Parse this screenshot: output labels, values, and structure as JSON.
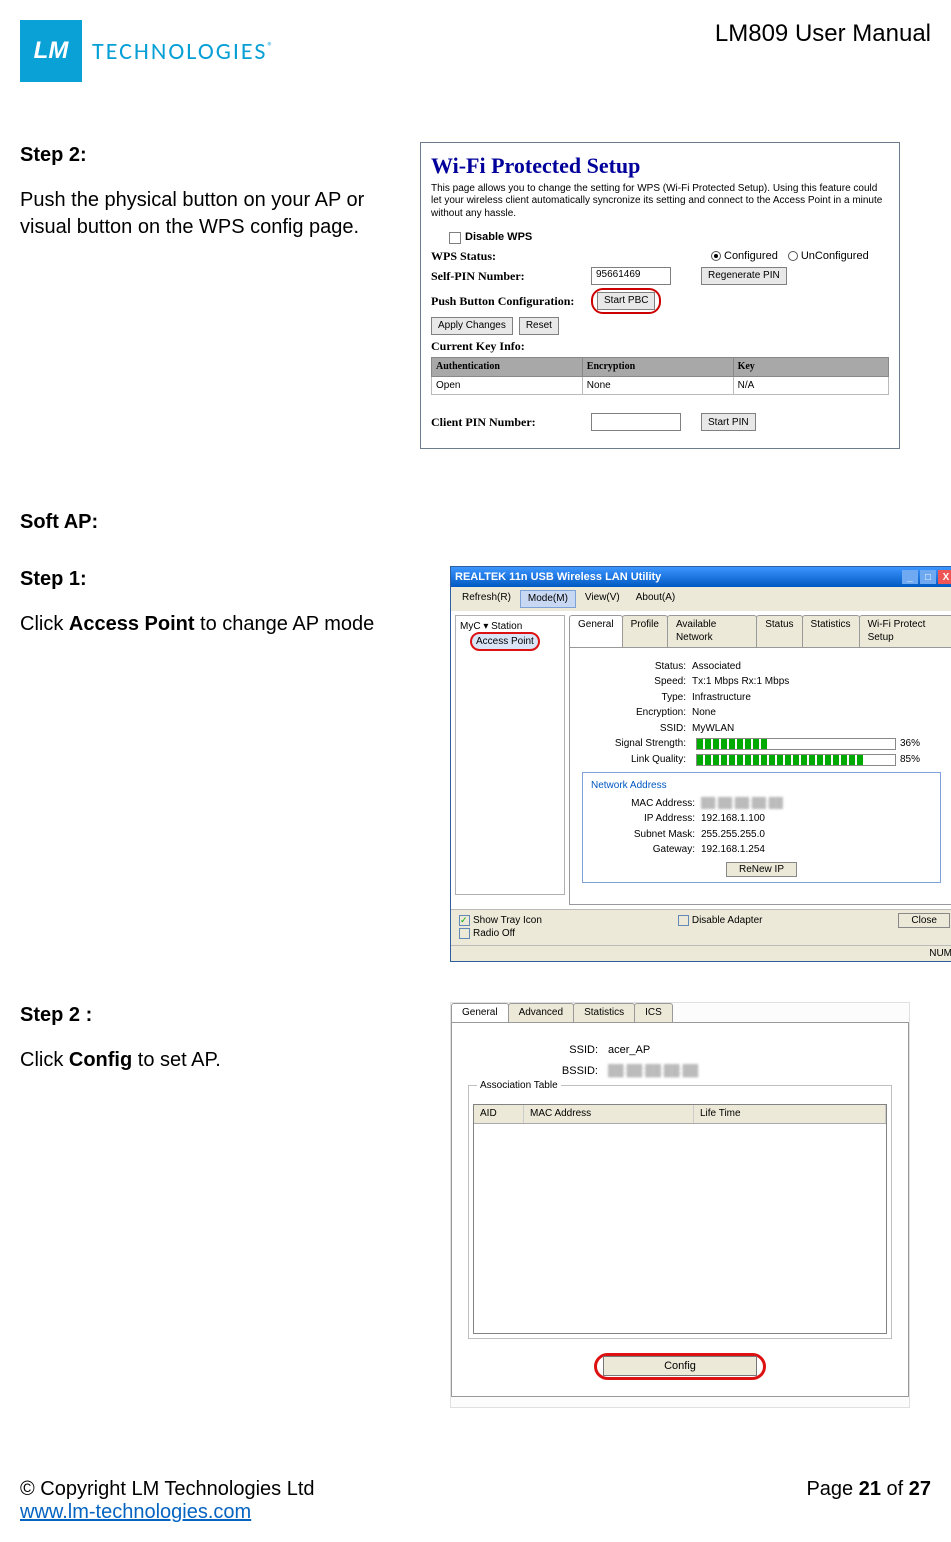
{
  "header": {
    "logo_text": "TECHNOLOGIES",
    "logo_mark": "LM",
    "reg": "®",
    "doc_title": "LM809 User Manual"
  },
  "section1": {
    "step_label": "Step 2:",
    "para": "Push the physical button on your AP or visual button on the WPS config page.",
    "shot": {
      "title": "Wi-Fi Protected Setup",
      "desc": "This page allows you to change the setting for WPS (Wi-Fi Protected Setup). Using this feature could let your wireless client automatically syncronize its setting and connect to the Access Point in a minute without any hassle.",
      "disable_wps_label": "Disable WPS",
      "rows": {
        "status_lbl": "WPS Status:",
        "status_opt1": "Configured",
        "status_opt2": "UnConfigured",
        "pin_lbl": "Self-PIN Number:",
        "pin_val": "95661469",
        "regen_btn": "Regenerate PIN",
        "pbc_lbl": "Push Button Configuration:",
        "pbc_btn": "Start PBC",
        "apply_btn": "Apply Changes",
        "reset_btn": "Reset",
        "keyinfo_lbl": "Current Key Info:",
        "th_auth": "Authentication",
        "th_enc": "Encryption",
        "th_key": "Key",
        "td_auth": "Open",
        "td_enc": "None",
        "td_key": "N/A",
        "client_lbl": "Client PIN Number:",
        "start_pin_btn": "Start PIN"
      }
    }
  },
  "softap": {
    "label": "Soft AP:"
  },
  "section2": {
    "step_label": "Step 1:",
    "para_pre": "Click ",
    "para_bold": "Access Point",
    "para_post": " to change AP mode",
    "shot": {
      "titlebar": "REALTEK 11n USB Wireless LAN Utility",
      "menu": {
        "refresh": "Refresh(R)",
        "mode": "Mode(M)",
        "view": "View(V)",
        "about": "About(A)"
      },
      "tree_root": "MyC ▾ Station",
      "ap_item": "Access Point",
      "tabs": {
        "general": "General",
        "profile": "Profile",
        "avail": "Available Network",
        "status": "Status",
        "stats": "Statistics",
        "wps": "Wi-Fi Protect Setup"
      },
      "fields": {
        "status_k": "Status:",
        "status_v": "Associated",
        "speed_k": "Speed:",
        "speed_v": "Tx:1 Mbps Rx:1 Mbps",
        "type_k": "Type:",
        "type_v": "Infrastructure",
        "enc_k": "Encryption:",
        "enc_v": "None",
        "ssid_k": "SSID:",
        "ssid_v": "MyWLAN",
        "sig_k": "Signal Strength:",
        "sig_pct": "36%",
        "link_k": "Link Quality:",
        "link_pct": "85%"
      },
      "na": {
        "title": "Network Address",
        "mac_k": "MAC Address:",
        "ip_k": "IP Address:",
        "ip_v": "192.168.1.100",
        "mask_k": "Subnet Mask:",
        "mask_v": "255.255.255.0",
        "gw_k": "Gateway:",
        "gw_v": "192.168.1.254",
        "renew_btn": "ReNew IP"
      },
      "bottom": {
        "tray": "Show Tray Icon",
        "radio": "Radio Off",
        "disable": "Disable Adapter",
        "close": "Close"
      },
      "statusbar": "NUM"
    }
  },
  "section3": {
    "step_label": "Step 2 :",
    "para_pre": "Click ",
    "para_bold": "Config",
    "para_post": " to set AP.",
    "shot": {
      "tabs": {
        "general": "General",
        "adv": "Advanced",
        "stats": "Statistics",
        "ics": "ICS"
      },
      "ssid_lbl": "SSID:",
      "ssid_val": "acer_AP",
      "bssid_lbl": "BSSID:",
      "assoc_title": "Association Table",
      "col_aid": "AID",
      "col_mac": "MAC Address",
      "col_life": "Life Time",
      "config_btn": "Config"
    }
  },
  "footer": {
    "copyright": "© Copyright LM Technologies Ltd",
    "url": "www.lm-technologies.com",
    "page_pre": "Page ",
    "page_cur": "21",
    "page_mid": " of ",
    "page_total": "27"
  }
}
